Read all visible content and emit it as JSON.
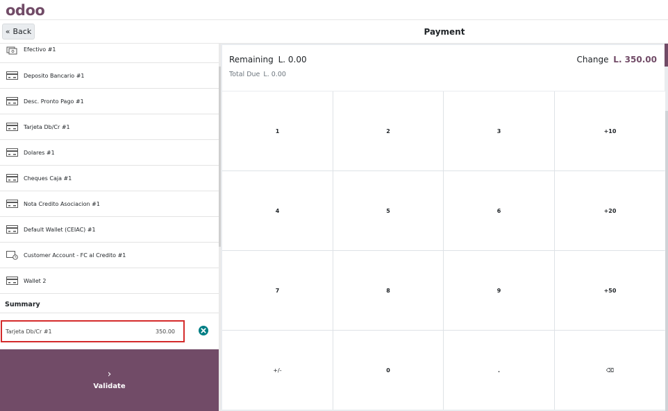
{
  "header": {
    "logo": "odoo",
    "back_label": "Back",
    "title": "Payment"
  },
  "payment_methods": [
    {
      "label": "Efectivo #1",
      "icon": "cash-icon"
    },
    {
      "label": "Deposito Bancario #1",
      "icon": "card-icon"
    },
    {
      "label": "Desc. Pronto Pago #1",
      "icon": "card-icon"
    },
    {
      "label": "Tarjeta Db/Cr #1",
      "icon": "card-icon"
    },
    {
      "label": "Dolares #1",
      "icon": "card-icon"
    },
    {
      "label": "Cheques Caja #1",
      "icon": "card-icon"
    },
    {
      "label": "Nota Credito Asociacion #1",
      "icon": "card-icon"
    },
    {
      "label": "Default Wallet (CEIAC) #1",
      "icon": "card-icon"
    },
    {
      "label": "Customer Account - FC al Credito #1",
      "icon": "account-icon"
    },
    {
      "label": "Wallet 2",
      "icon": "card-icon"
    }
  ],
  "summary": {
    "title": "Summary",
    "lines": [
      {
        "method": "Tarjeta Db/Cr #1",
        "amount": "350.00"
      }
    ]
  },
  "validate": {
    "label": "Validate"
  },
  "status": {
    "remaining_label": "Remaining",
    "remaining_value": "L. 0.00",
    "total_due_label": "Total Due",
    "total_due_value": "L. 0.00",
    "change_label": "Change",
    "change_value": "L. 350.00"
  },
  "numpad": {
    "keys": [
      "1",
      "2",
      "3",
      "+10",
      "4",
      "5",
      "6",
      "+20",
      "7",
      "8",
      "9",
      "+50",
      "+/-",
      "0",
      ".",
      "⌫"
    ]
  },
  "colors": {
    "accent": "#714B67",
    "highlight_border": "#d42a2a",
    "delete": "#017e84"
  }
}
